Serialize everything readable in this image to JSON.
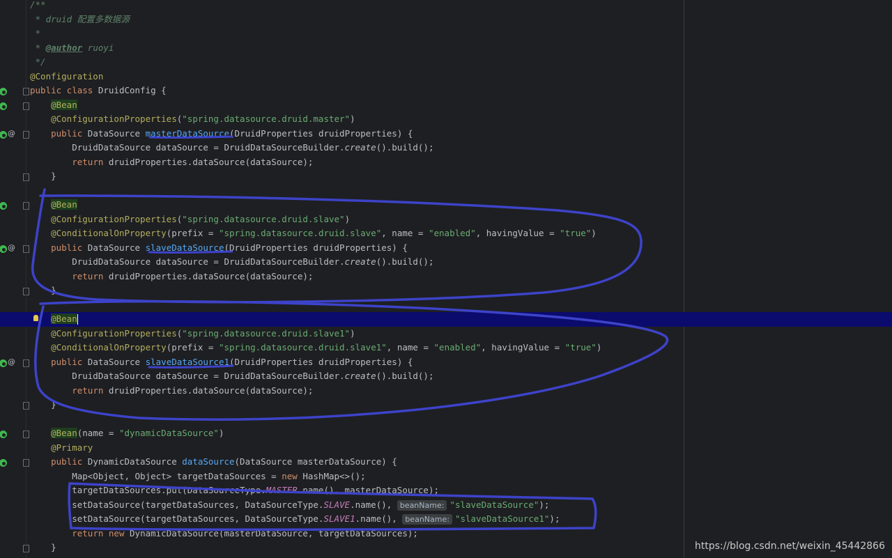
{
  "editor": {
    "accent": "#3d43c9",
    "current_line_bg": "#0b0b6e",
    "lines": [
      {
        "row": 0,
        "tokens": [
          {
            "t": "/**",
            "c": "comment"
          }
        ]
      },
      {
        "row": 1,
        "tokens": [
          {
            "t": " * druid 配置多数据源",
            "c": "comment"
          }
        ]
      },
      {
        "row": 2,
        "tokens": [
          {
            "t": " *",
            "c": "comment"
          }
        ]
      },
      {
        "row": 3,
        "tokens": [
          {
            "t": " * ",
            "c": "comment"
          },
          {
            "t": "@author",
            "c": "tag"
          },
          {
            "t": " ruoyi",
            "c": "comment"
          }
        ]
      },
      {
        "row": 4,
        "tokens": [
          {
            "t": " */",
            "c": "comment"
          }
        ]
      },
      {
        "row": 5,
        "tokens": [
          {
            "t": "@Configuration",
            "c": "ann"
          }
        ]
      },
      {
        "row": 6,
        "tokens": [
          {
            "t": "public class ",
            "c": "kw"
          },
          {
            "t": "DruidConfig {",
            "c": "plain"
          }
        ]
      },
      {
        "row": 7,
        "tokens": [
          {
            "t": "    ",
            "c": "plain"
          },
          {
            "t": "@Bean",
            "c": "bean"
          }
        ]
      },
      {
        "row": 8,
        "tokens": [
          {
            "t": "    ",
            "c": "plain"
          },
          {
            "t": "@ConfigurationProperties",
            "c": "ann"
          },
          {
            "t": "(",
            "c": "plain"
          },
          {
            "t": "\"spring.datasource.druid.master\"",
            "c": "str"
          },
          {
            "t": ")",
            "c": "plain"
          }
        ]
      },
      {
        "row": 9,
        "tokens": [
          {
            "t": "    ",
            "c": "plain"
          },
          {
            "t": "public ",
            "c": "kw"
          },
          {
            "t": "DataSource ",
            "c": "plain"
          },
          {
            "t": "masterDataSource",
            "c": "fn"
          },
          {
            "t": "(DruidProperties druidProperties) {",
            "c": "plain"
          }
        ]
      },
      {
        "row": 10,
        "tokens": [
          {
            "t": "        DruidDataSource dataSource = DruidDataSourceBuilder.",
            "c": "plain"
          },
          {
            "t": "create",
            "c": "static"
          },
          {
            "t": "().build();",
            "c": "plain"
          }
        ]
      },
      {
        "row": 11,
        "tokens": [
          {
            "t": "        ",
            "c": "plain"
          },
          {
            "t": "return ",
            "c": "kw"
          },
          {
            "t": "druidProperties.dataSource(dataSource);",
            "c": "plain"
          }
        ]
      },
      {
        "row": 12,
        "tokens": [
          {
            "t": "    }",
            "c": "plain"
          }
        ]
      },
      {
        "row": 13,
        "tokens": []
      },
      {
        "row": 14,
        "tokens": [
          {
            "t": "    ",
            "c": "plain"
          },
          {
            "t": "@Bean",
            "c": "bean"
          }
        ]
      },
      {
        "row": 15,
        "tokens": [
          {
            "t": "    ",
            "c": "plain"
          },
          {
            "t": "@ConfigurationProperties",
            "c": "ann"
          },
          {
            "t": "(",
            "c": "plain"
          },
          {
            "t": "\"spring.datasource.druid.slave\"",
            "c": "str"
          },
          {
            "t": ")",
            "c": "plain"
          }
        ]
      },
      {
        "row": 16,
        "tokens": [
          {
            "t": "    ",
            "c": "plain"
          },
          {
            "t": "@ConditionalOnProperty",
            "c": "ann"
          },
          {
            "t": "(prefix = ",
            "c": "plain"
          },
          {
            "t": "\"spring.datasource.druid.slave\"",
            "c": "str"
          },
          {
            "t": ", name = ",
            "c": "plain"
          },
          {
            "t": "\"enabled\"",
            "c": "str"
          },
          {
            "t": ", havingValue = ",
            "c": "plain"
          },
          {
            "t": "\"true\"",
            "c": "str"
          },
          {
            "t": ")",
            "c": "plain"
          }
        ]
      },
      {
        "row": 17,
        "tokens": [
          {
            "t": "    ",
            "c": "plain"
          },
          {
            "t": "public ",
            "c": "kw"
          },
          {
            "t": "DataSource ",
            "c": "plain"
          },
          {
            "t": "slaveDataSource",
            "c": "fn"
          },
          {
            "t": "(DruidProperties druidProperties) {",
            "c": "plain"
          }
        ]
      },
      {
        "row": 18,
        "tokens": [
          {
            "t": "        DruidDataSource dataSource = DruidDataSourceBuilder.",
            "c": "plain"
          },
          {
            "t": "create",
            "c": "static"
          },
          {
            "t": "().build();",
            "c": "plain"
          }
        ]
      },
      {
        "row": 19,
        "tokens": [
          {
            "t": "        ",
            "c": "plain"
          },
          {
            "t": "return ",
            "c": "kw"
          },
          {
            "t": "druidProperties.dataSource(dataSource);",
            "c": "plain"
          }
        ]
      },
      {
        "row": 20,
        "tokens": [
          {
            "t": "    }",
            "c": "plain"
          }
        ]
      },
      {
        "row": 21,
        "tokens": []
      },
      {
        "row": 22,
        "current": true,
        "tokens": [
          {
            "t": "    ",
            "c": "plain"
          },
          {
            "t": "@Bean",
            "c": "bean"
          },
          {
            "t": "",
            "c": "caret"
          }
        ]
      },
      {
        "row": 23,
        "tokens": [
          {
            "t": "    ",
            "c": "plain"
          },
          {
            "t": "@ConfigurationProperties",
            "c": "ann"
          },
          {
            "t": "(",
            "c": "plain"
          },
          {
            "t": "\"spring.datasource.druid.slave1\"",
            "c": "str"
          },
          {
            "t": ")",
            "c": "plain"
          }
        ]
      },
      {
        "row": 24,
        "tokens": [
          {
            "t": "    ",
            "c": "plain"
          },
          {
            "t": "@ConditionalOnProperty",
            "c": "ann"
          },
          {
            "t": "(prefix = ",
            "c": "plain"
          },
          {
            "t": "\"spring.datasource.druid.slave1\"",
            "c": "str"
          },
          {
            "t": ", name = ",
            "c": "plain"
          },
          {
            "t": "\"enabled\"",
            "c": "str"
          },
          {
            "t": ", havingValue = ",
            "c": "plain"
          },
          {
            "t": "\"true\"",
            "c": "str"
          },
          {
            "t": ")",
            "c": "plain"
          }
        ]
      },
      {
        "row": 25,
        "tokens": [
          {
            "t": "    ",
            "c": "plain"
          },
          {
            "t": "public ",
            "c": "kw"
          },
          {
            "t": "DataSource ",
            "c": "plain"
          },
          {
            "t": "slaveDataSource1",
            "c": "fn"
          },
          {
            "t": "(DruidProperties druidProperties) {",
            "c": "plain"
          }
        ]
      },
      {
        "row": 26,
        "tokens": [
          {
            "t": "        DruidDataSource dataSource = DruidDataSourceBuilder.",
            "c": "plain"
          },
          {
            "t": "create",
            "c": "static"
          },
          {
            "t": "().build();",
            "c": "plain"
          }
        ]
      },
      {
        "row": 27,
        "tokens": [
          {
            "t": "        ",
            "c": "plain"
          },
          {
            "t": "return ",
            "c": "kw"
          },
          {
            "t": "druidProperties.dataSource(dataSource);",
            "c": "plain"
          }
        ]
      },
      {
        "row": 28,
        "tokens": [
          {
            "t": "    }",
            "c": "plain"
          }
        ]
      },
      {
        "row": 29,
        "tokens": []
      },
      {
        "row": 30,
        "tokens": [
          {
            "t": "    ",
            "c": "plain"
          },
          {
            "t": "@Bean",
            "c": "bean"
          },
          {
            "t": "(name = ",
            "c": "plain"
          },
          {
            "t": "\"dynamicDataSource\"",
            "c": "str"
          },
          {
            "t": ")",
            "c": "plain"
          }
        ]
      },
      {
        "row": 31,
        "tokens": [
          {
            "t": "    ",
            "c": "plain"
          },
          {
            "t": "@Primary",
            "c": "ann"
          }
        ]
      },
      {
        "row": 32,
        "tokens": [
          {
            "t": "    ",
            "c": "plain"
          },
          {
            "t": "public ",
            "c": "kw"
          },
          {
            "t": "DynamicDataSource ",
            "c": "plain"
          },
          {
            "t": "dataSource",
            "c": "fn"
          },
          {
            "t": "(DataSource masterDataSource) {",
            "c": "plain"
          }
        ]
      },
      {
        "row": 33,
        "tokens": [
          {
            "t": "        Map<Object, Object> targetDataSources = ",
            "c": "plain"
          },
          {
            "t": "new ",
            "c": "kw"
          },
          {
            "t": "HashMap<>();",
            "c": "plain"
          }
        ]
      },
      {
        "row": 34,
        "tokens": [
          {
            "t": "        targetDataSources.put(DataSourceType.",
            "c": "plain"
          },
          {
            "t": "MASTER",
            "c": "const"
          },
          {
            "t": ".name(), masterDataSource);",
            "c": "plain"
          }
        ]
      },
      {
        "row": 35,
        "tokens": [
          {
            "t": "        setDataSource(targetDataSources, DataSourceType.",
            "c": "plain"
          },
          {
            "t": "SLAVE",
            "c": "const"
          },
          {
            "t": ".name(), ",
            "c": "plain"
          },
          {
            "t": "beanName:",
            "c": "hint"
          },
          {
            "t": "\"slaveDataSource\"",
            "c": "str"
          },
          {
            "t": ");",
            "c": "plain"
          }
        ]
      },
      {
        "row": 36,
        "tokens": [
          {
            "t": "        setDataSource(targetDataSources, DataSourceType.",
            "c": "plain"
          },
          {
            "t": "SLAVE1",
            "c": "const"
          },
          {
            "t": ".name(), ",
            "c": "plain"
          },
          {
            "t": "beanName:",
            "c": "hint"
          },
          {
            "t": "\"slaveDataSource1\"",
            "c": "str"
          },
          {
            "t": ");",
            "c": "plain"
          }
        ]
      },
      {
        "row": 37,
        "tokens": [
          {
            "t": "        ",
            "c": "plain"
          },
          {
            "t": "return new ",
            "c": "kw"
          },
          {
            "t": "DynamicDataSource(masterDataSource, targetDataSources);",
            "c": "plain"
          }
        ]
      },
      {
        "row": 38,
        "tokens": [
          {
            "t": "    }",
            "c": "plain"
          }
        ]
      }
    ],
    "gutter": [
      {
        "row": 6,
        "icons": [
          "bean-run-icon",
          "fold-icon"
        ]
      },
      {
        "row": 7,
        "icons": [
          "bean-run-icon",
          "fold-icon"
        ]
      },
      {
        "row": 9,
        "icons": [
          "bean-run-icon",
          "at-icon",
          "fold-icon"
        ]
      },
      {
        "row": 12,
        "icons": [
          "fold-icon"
        ]
      },
      {
        "row": 14,
        "icons": [
          "bean-run-icon",
          "fold-icon"
        ]
      },
      {
        "row": 17,
        "icons": [
          "bean-run-icon",
          "at-icon",
          "fold-icon"
        ]
      },
      {
        "row": 20,
        "icons": [
          "fold-icon"
        ]
      },
      {
        "row": 22,
        "icons": [
          "bean-run-icon",
          "fold-icon",
          "bulb-icon"
        ]
      },
      {
        "row": 25,
        "icons": [
          "bean-run-icon",
          "at-icon",
          "fold-icon"
        ]
      },
      {
        "row": 28,
        "icons": [
          "fold-icon"
        ]
      },
      {
        "row": 30,
        "icons": [
          "bean-run-icon",
          "fold-icon"
        ]
      },
      {
        "row": 32,
        "icons": [
          "bean-run-icon",
          "fold-icon"
        ]
      },
      {
        "row": 38,
        "icons": [
          "fold-icon"
        ]
      }
    ]
  },
  "watermark": "https://blog.csdn.net/weixin_45442866"
}
